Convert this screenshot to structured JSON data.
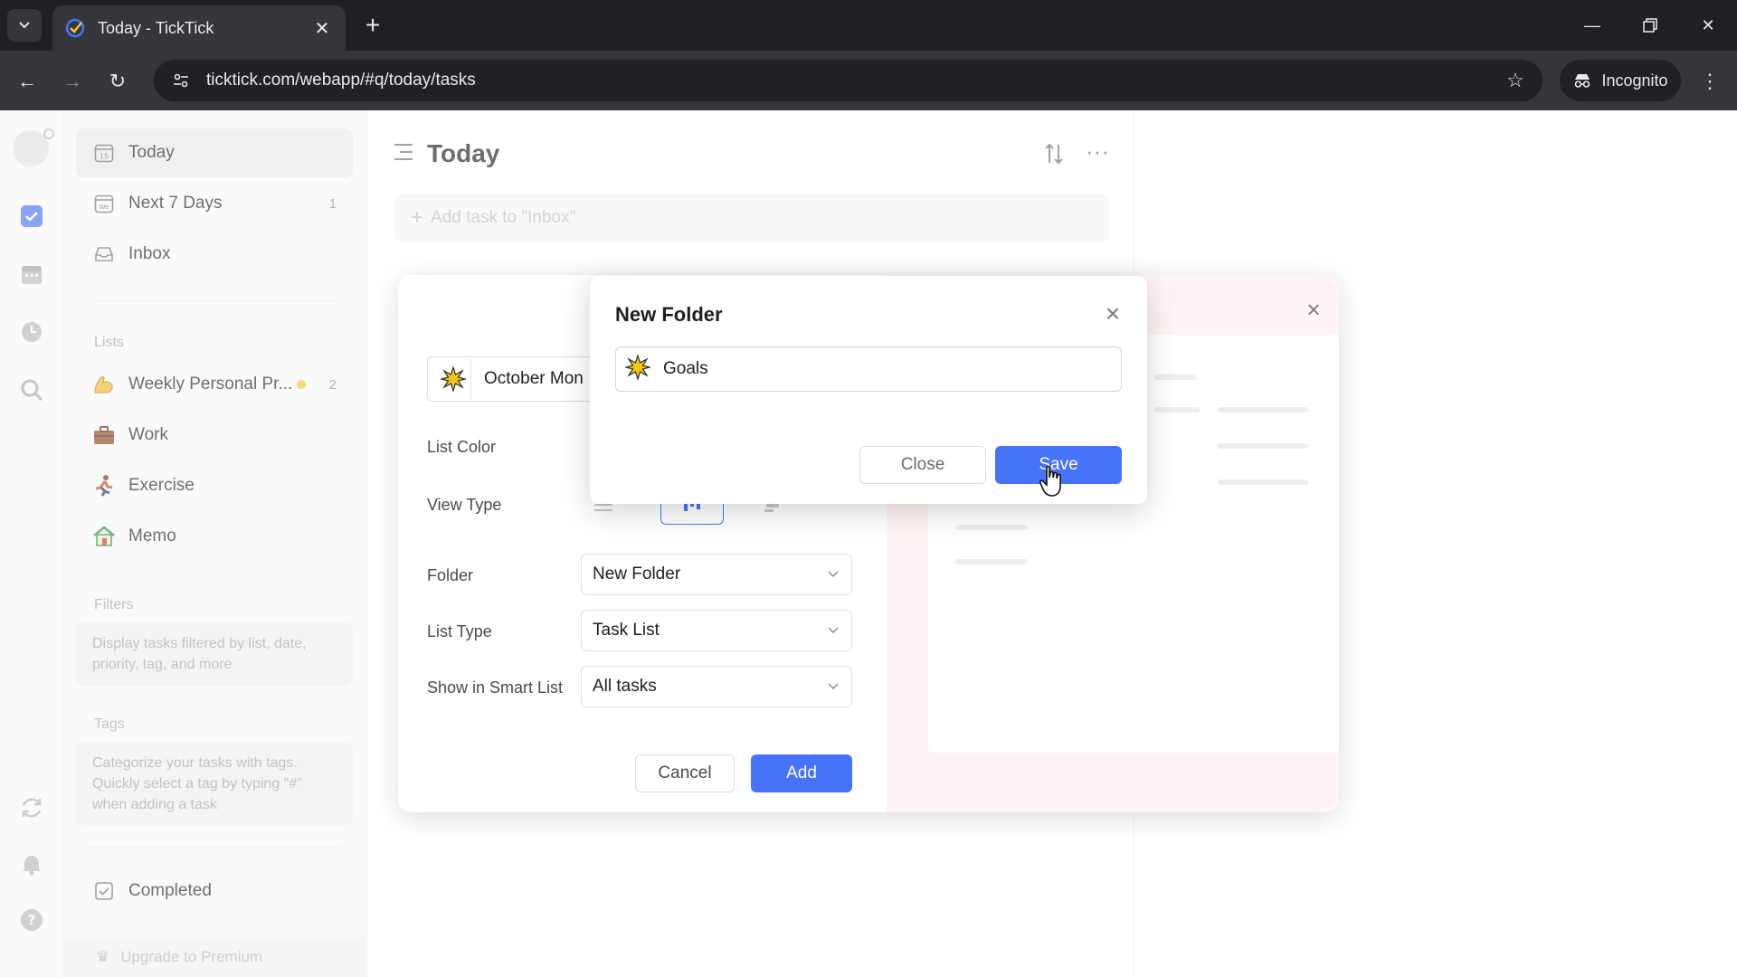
{
  "browser": {
    "tab_title": "Today - TickTick",
    "url": "ticktick.com/webapp/#q/today/tasks",
    "incognito_label": "Incognito"
  },
  "rail": {
    "icons": [
      "avatar",
      "checkbox-icon",
      "calendar-icon",
      "clock-icon",
      "search-icon",
      "sync-icon",
      "bell-icon",
      "help-icon"
    ]
  },
  "sidebar": {
    "smart": [
      {
        "label": "Today",
        "icon": "calendar-day-icon",
        "count": ""
      },
      {
        "label": "Next 7 Days",
        "icon": "calendar-week-icon",
        "count": "1"
      },
      {
        "label": "Inbox",
        "icon": "inbox-icon",
        "count": ""
      }
    ],
    "lists_title": "Lists",
    "lists": [
      {
        "label": "Weekly Personal Pr...",
        "icon": "flexed-arm-emoji",
        "count": "2"
      },
      {
        "label": "Work",
        "icon": "briefcase-emoji",
        "count": ""
      },
      {
        "label": "Exercise",
        "icon": "runner-emoji",
        "count": ""
      },
      {
        "label": "Memo",
        "icon": "house-emoji",
        "count": ""
      }
    ],
    "filters_title": "Filters",
    "filters_hint": "Display tasks filtered by list, date, priority, tag, and more",
    "tags_title": "Tags",
    "tags_hint": "Categorize your tasks with tags. Quickly select a tag by typing \"#\" when adding a task",
    "completed_label": "Completed",
    "upgrade_label": "Upgrade to Premium"
  },
  "main": {
    "title": "Today",
    "add_task_placeholder": "Add task to \"Inbox\""
  },
  "list_dialog": {
    "name_value": "October Mon",
    "list_color_label": "List Color",
    "view_type_label": "View Type",
    "folder_label": "Folder",
    "folder_value": "New Folder",
    "list_type_label": "List Type",
    "list_type_value": "Task List",
    "smart_list_label": "Show in Smart List",
    "smart_list_value": "All tasks",
    "cancel_label": "Cancel",
    "add_label": "Add"
  },
  "folder_modal": {
    "title": "New Folder",
    "input_value": "Goals",
    "close_label": "Close",
    "save_label": "Save"
  },
  "colors": {
    "accent": "#4772fa",
    "preview_bg": "#fff4f5",
    "yellow_dot": "#f2c530"
  }
}
